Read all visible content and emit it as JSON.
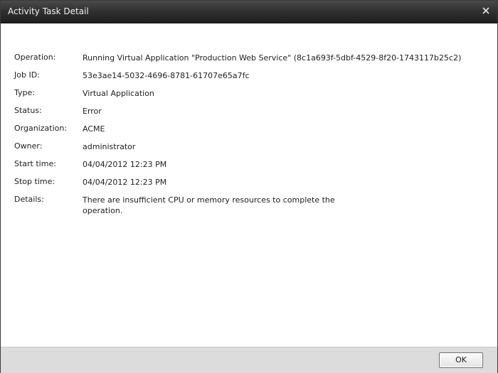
{
  "window": {
    "title": "Activity Task Detail",
    "close_icon": "close-icon"
  },
  "details": [
    {
      "label": "Operation:",
      "value": "Running Virtual Application \"Production Web Service\" (8c1a693f-5dbf-4529-8f20-1743117b25c2)"
    },
    {
      "label": "Job ID:",
      "value": "53e3ae14-5032-4696-8781-61707e65a7fc"
    },
    {
      "label": "Type:",
      "value": "Virtual Application"
    },
    {
      "label": "Status:",
      "value": "Error"
    },
    {
      "label": "Organization:",
      "value": "ACME"
    },
    {
      "label": "Owner:",
      "value": "administrator"
    },
    {
      "label": "Start time:",
      "value": "04/04/2012 12:23 PM"
    },
    {
      "label": "Stop time:",
      "value": "04/04/2012 12:23 PM"
    },
    {
      "label": "Details:",
      "value": "There are insufficient CPU or memory resources to complete the operation."
    }
  ],
  "footer": {
    "ok_label": "OK"
  },
  "colors": {
    "titlebar": "#2f2f2f",
    "title_text": "#f2f2f2",
    "footer": "#dcdcdc",
    "text": "#1e1e1e"
  }
}
